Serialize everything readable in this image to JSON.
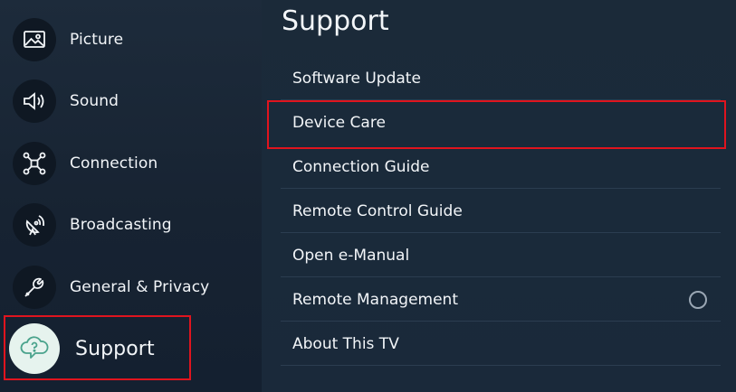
{
  "sidebar": {
    "items": [
      {
        "label": "Picture",
        "icon": "picture-icon"
      },
      {
        "label": "Sound",
        "icon": "speaker-icon"
      },
      {
        "label": "Connection",
        "icon": "network-icon"
      },
      {
        "label": "Broadcasting",
        "icon": "broadcast-icon"
      },
      {
        "label": "General & Privacy",
        "icon": "wrench-icon"
      },
      {
        "label": "Support",
        "icon": "support-cloud-icon",
        "selected": true
      }
    ]
  },
  "main": {
    "title": "Support",
    "items": [
      {
        "label": "Software Update"
      },
      {
        "label": "Device Care",
        "highlighted": true
      },
      {
        "label": "Connection Guide"
      },
      {
        "label": "Remote Control Guide"
      },
      {
        "label": "Open e-Manual"
      },
      {
        "label": "Remote Management",
        "control": "radio-button"
      },
      {
        "label": "About This TV"
      }
    ]
  },
  "colors": {
    "highlight": "#e0141e",
    "background": "#1a2a3a",
    "text": "#f2f5f8"
  }
}
